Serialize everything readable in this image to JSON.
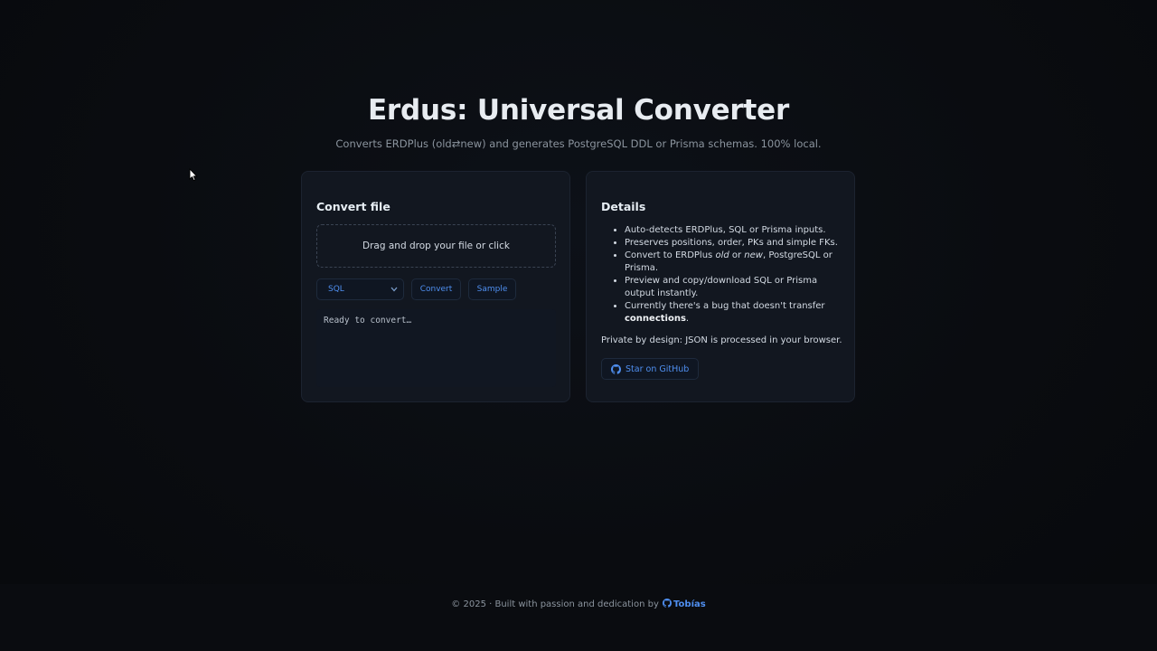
{
  "header": {
    "title": "Erdus: Universal Converter",
    "subtitle": "Converts ERDPlus (old⇄new) and generates PostgreSQL DDL or Prisma schemas. 100% local."
  },
  "convert_card": {
    "heading": "Convert file",
    "dropzone_text": "Drag and drop your file or click",
    "format_select": {
      "selected": "SQL"
    },
    "convert_button": "Convert",
    "sample_button": "Sample",
    "output_text": "Ready to convert…"
  },
  "details_card": {
    "heading": "Details",
    "items": [
      {
        "text": "Auto-detects ERDPlus, SQL or Prisma inputs."
      },
      {
        "text": "Preserves positions, order, PKs and simple FKs."
      },
      {
        "before": "Convert to ERDPlus ",
        "em1": "old",
        "mid": " or ",
        "em2": "new",
        "after": ", PostgreSQL or Prisma."
      },
      {
        "text": "Preview and copy/download SQL or Prisma output instantly."
      },
      {
        "before": "Currently there's a bug that doesn't transfer ",
        "strong": "connections",
        "after": "."
      }
    ],
    "private_note": "Private by design: JSON is processed in your browser.",
    "github_button": "Star on GitHub"
  },
  "footer": {
    "text": "© 2025 · Built with passion and dedication by ",
    "author": "Tobías"
  },
  "colors": {
    "accent": "#4f8ff0",
    "background": "#0a0c10",
    "card": "#121720"
  },
  "icons": {
    "github": "github-icon",
    "chevron": "chevron-down-icon",
    "cursor": "mouse-pointer-icon"
  }
}
